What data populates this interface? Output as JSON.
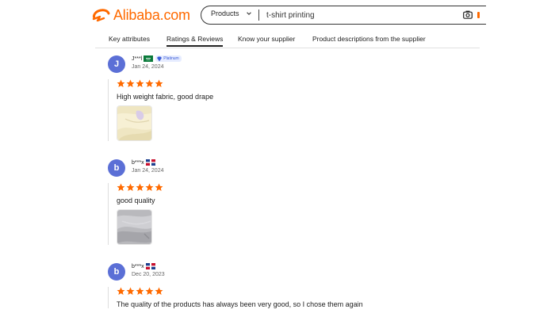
{
  "brand": {
    "name": "Alibaba.com",
    "color": "#ff6a00"
  },
  "search": {
    "category": "Products",
    "placeholder": "t-shirt printing",
    "icon_chevron": "chevron-down-icon",
    "icon_camera": "camera-icon"
  },
  "tabs": [
    {
      "label": "Key attributes",
      "active": false
    },
    {
      "label": "Ratings & Reviews",
      "active": true
    },
    {
      "label": "Know your supplier",
      "active": false
    },
    {
      "label": "Product descriptions from the supplier",
      "active": false
    }
  ],
  "reviews": [
    {
      "avatar_letter": "J",
      "user": "J***l",
      "flag": "saudi-arabia-flag",
      "badge": "Platinum",
      "date": "Jan 24, 2024",
      "stars": 5,
      "text": "High weight fabric, good drape",
      "photo": "cream-fabric-photo"
    },
    {
      "avatar_letter": "b",
      "user": "b***x",
      "flag": "dominican-republic-flag",
      "date": "Jan 24, 2024",
      "stars": 5,
      "text": "good quality",
      "photo": "gray-fabric-photo"
    },
    {
      "avatar_letter": "b",
      "user": "b***x",
      "flag": "dominican-republic-flag",
      "date": "Dec 20, 2023",
      "stars": 5,
      "text": "The quality of the products has always been very good, so I chose them again"
    }
  ],
  "colors": {
    "star": "#ff6a00",
    "avatar": "#5b6fd6",
    "badge_bg": "#e6ecff"
  }
}
